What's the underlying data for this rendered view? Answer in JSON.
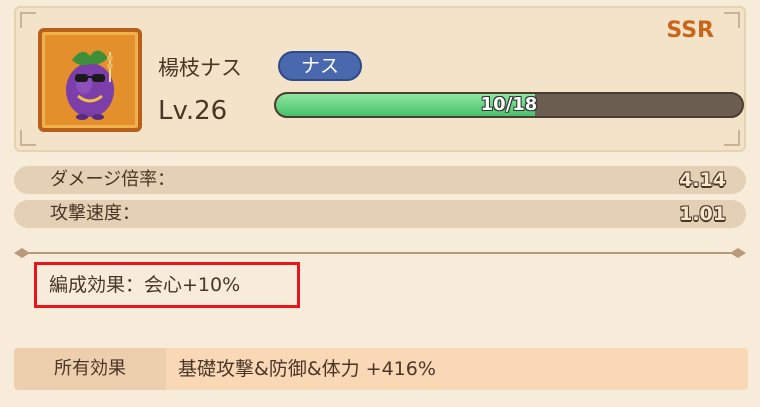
{
  "card": {
    "rarity": "SSR",
    "name": "楊枝ナス",
    "tag": "ナス",
    "level": "Lv.26",
    "progress_text": "10/18",
    "progress": {
      "current": 10,
      "max": 18
    },
    "portrait_icon": "eggplant-character-icon"
  },
  "stats": [
    {
      "label": "ダメージ倍率：",
      "value": "4.14"
    },
    {
      "label": "攻撃速度：",
      "value": "1.01"
    }
  ],
  "formation_effect": "編成効果：会心+10%",
  "owned_effect": {
    "label": "所有効果",
    "value": "基礎攻撃&防御&体力 +416%"
  },
  "colors": {
    "accent": "#c8661c",
    "tag_bg": "#4a68ad",
    "progress_fill": "#48c36a",
    "highlight_border": "#e8151a"
  }
}
